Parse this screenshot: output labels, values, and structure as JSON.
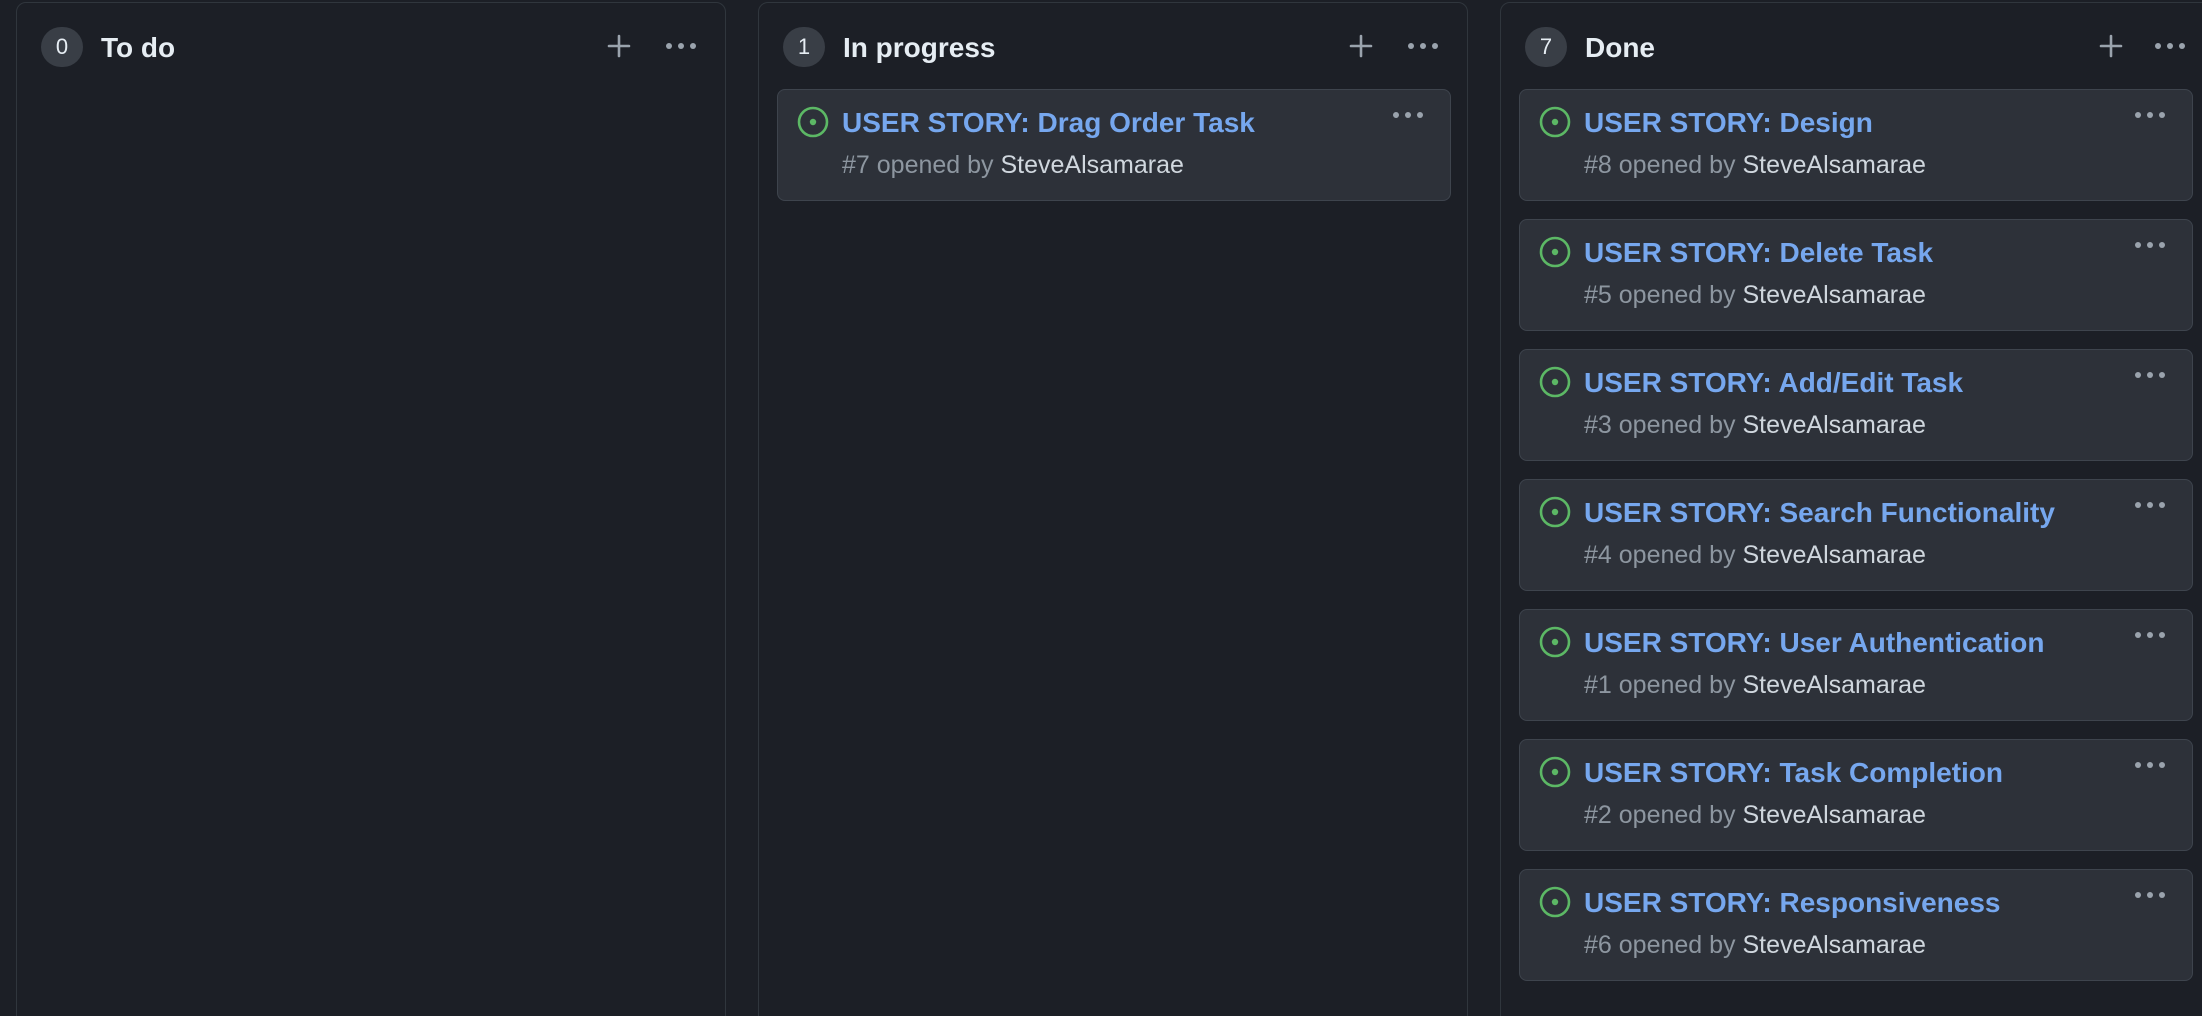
{
  "columns": [
    {
      "count": "0",
      "title": "To do",
      "add_icon": "plus-icon",
      "menu_icon": "kebab-horizontal-icon",
      "cards": []
    },
    {
      "count": "1",
      "title": "In progress",
      "add_icon": "plus-icon",
      "menu_icon": "kebab-horizontal-icon",
      "cards": [
        {
          "title": "USER STORY: Drag Order Task",
          "number": "#7",
          "opened_by": "opened by",
          "author": "SteveAlsamarae"
        }
      ]
    },
    {
      "count": "7",
      "title": "Done",
      "add_icon": "plus-icon",
      "menu_icon": "kebab-horizontal-icon",
      "cards": [
        {
          "title": "USER STORY: Design",
          "number": "#8",
          "opened_by": "opened by",
          "author": "SteveAlsamarae"
        },
        {
          "title": "USER STORY: Delete Task",
          "number": "#5",
          "opened_by": "opened by",
          "author": "SteveAlsamarae"
        },
        {
          "title": "USER STORY: Add/Edit Task",
          "number": "#3",
          "opened_by": "opened by",
          "author": "SteveAlsamarae"
        },
        {
          "title": "USER STORY: Search Functionality",
          "number": "#4",
          "opened_by": "opened by",
          "author": "SteveAlsamarae"
        },
        {
          "title": "USER STORY: User Authentication",
          "number": "#1",
          "opened_by": "opened by",
          "author": "SteveAlsamarae"
        },
        {
          "title": "USER STORY: Task Completion",
          "number": "#2",
          "opened_by": "opened by",
          "author": "SteveAlsamarae"
        },
        {
          "title": "USER STORY: Responsiveness",
          "number": "#6",
          "opened_by": "opened by",
          "author": "SteveAlsamarae"
        }
      ]
    }
  ],
  "colors": {
    "background": "#1c1f26",
    "card_background": "#2d3139",
    "issue_open_green": "#5cb865",
    "link_blue": "#76a7ee",
    "muted_text": "#8d96a0"
  }
}
